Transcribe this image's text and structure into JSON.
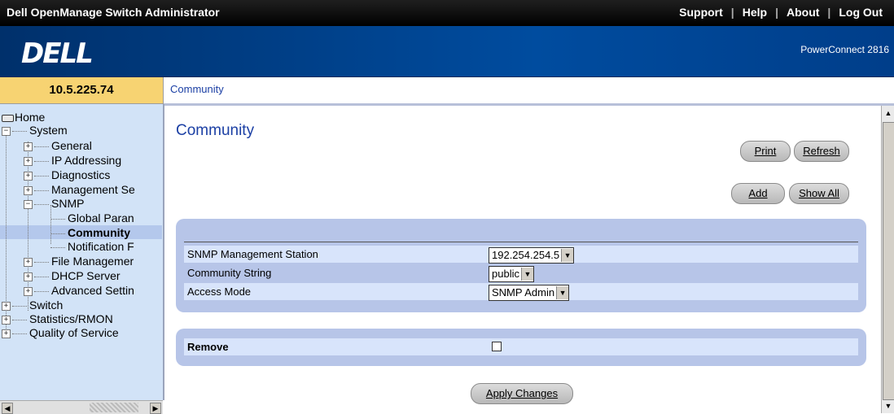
{
  "header": {
    "app_title": "Dell OpenManage Switch Administrator",
    "links": [
      "Support",
      "Help",
      "About",
      "Log Out"
    ],
    "logo": "DELL",
    "product": "PowerConnect 2816"
  },
  "device": {
    "ip": "10.5.225.74"
  },
  "breadcrumb": "Community",
  "tree": {
    "items": [
      {
        "label": "Home",
        "icon": "home-icon"
      },
      {
        "label": "System",
        "expander": "−"
      },
      {
        "label": "General",
        "expander": "+"
      },
      {
        "label": "IP Addressing",
        "expander": "+"
      },
      {
        "label": "Diagnostics",
        "expander": "+"
      },
      {
        "label": "Management Se",
        "expander": "+"
      },
      {
        "label": "SNMP",
        "expander": "−"
      },
      {
        "label": "Global Paran"
      },
      {
        "label": "Community"
      },
      {
        "label": "Notification F"
      },
      {
        "label": "File Managemer",
        "expander": "+"
      },
      {
        "label": "DHCP Server",
        "expander": "+"
      },
      {
        "label": "Advanced Settin",
        "expander": "+"
      },
      {
        "label": "Switch",
        "expander": "+"
      },
      {
        "label": "Statistics/RMON",
        "expander": "+"
      },
      {
        "label": "Quality of Service",
        "expander": "+"
      }
    ]
  },
  "page": {
    "title": "Community",
    "buttons": {
      "print": "Print",
      "refresh": "Refresh",
      "add": "Add",
      "show_all": "Show All",
      "apply": "Apply Changes"
    },
    "fields": {
      "station_label": "SNMP Management Station",
      "station_value": "192.254.254.5",
      "community_label": "Community String",
      "community_value": "public",
      "access_label": "Access Mode",
      "access_value": "SNMP Admin"
    },
    "remove_label": "Remove",
    "remove_checked": false
  },
  "colors": {
    "panel": "#b7c5e8",
    "row_highlight": "#d8e4fb",
    "tree_bg": "#d2e3f7",
    "ip_bar": "#f7d372",
    "title_blue": "#1b3fa4"
  }
}
